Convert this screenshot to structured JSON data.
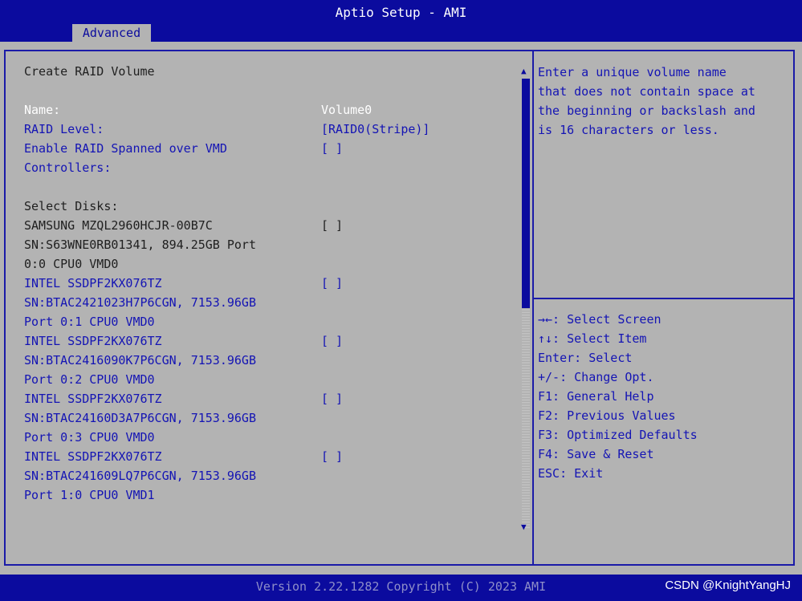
{
  "header": {
    "title": "Aptio Setup - AMI",
    "tab": "Advanced"
  },
  "main": {
    "section_title": "Create RAID Volume",
    "name_label": "Name:",
    "name_value": "Volume0",
    "raid_level_label": "RAID Level:",
    "raid_level_value": "[RAID0(Stripe)]",
    "spanned_label_1": "Enable RAID Spanned over VMD",
    "spanned_label_2": "Controllers:",
    "spanned_value": "[ ]",
    "select_disks_label": "Select Disks:",
    "disks": [
      {
        "line1": "SAMSUNG MZQL2960HCJR-00B7C",
        "line2": "SN:S63WNE0RB01341, 894.25GB  Port",
        "line3": "0:0 CPU0 VMD0",
        "value": "[ ]"
      },
      {
        "line1": "INTEL SSDPF2KX076TZ",
        "line2": "SN:BTAC2421023H7P6CGN, 7153.96GB",
        "line3": "Port 0:1 CPU0 VMD0",
        "value": "[ ]"
      },
      {
        "line1": "INTEL SSDPF2KX076TZ",
        "line2": "SN:BTAC2416090K7P6CGN, 7153.96GB",
        "line3": "Port 0:2 CPU0 VMD0",
        "value": "[ ]"
      },
      {
        "line1": "INTEL SSDPF2KX076TZ",
        "line2": "SN:BTAC24160D3A7P6CGN, 7153.96GB",
        "line3": "Port 0:3 CPU0 VMD0",
        "value": "[ ]"
      },
      {
        "line1": "INTEL SSDPF2KX076TZ",
        "line2": "SN:BTAC241609LQ7P6CGN, 7153.96GB",
        "line3": "Port 1:0 CPU0 VMD1",
        "value": "[ ]"
      }
    ]
  },
  "help": {
    "text": "Enter a unique volume name\nthat does not contain space at\nthe beginning or backslash and\nis 16 characters or less."
  },
  "keys": [
    "→←: Select Screen",
    "↑↓: Select Item",
    "Enter: Select",
    "+/-: Change Opt.",
    "F1: General Help",
    "F2: Previous Values",
    "F3: Optimized Defaults",
    "F4: Save & Reset",
    "ESC: Exit"
  ],
  "footer": {
    "version": "Version 2.22.1282 Copyright (C) 2023 AMI",
    "watermark": "CSDN @KnightYangHJ"
  },
  "colors": {
    "bar": "#0b0b9e",
    "panel": "#b3b3b3",
    "selectable_text": "#1414b4",
    "static_text": "#202020"
  },
  "icons": {
    "scroll_up": "up-triangle",
    "scroll_down": "down-triangle"
  }
}
